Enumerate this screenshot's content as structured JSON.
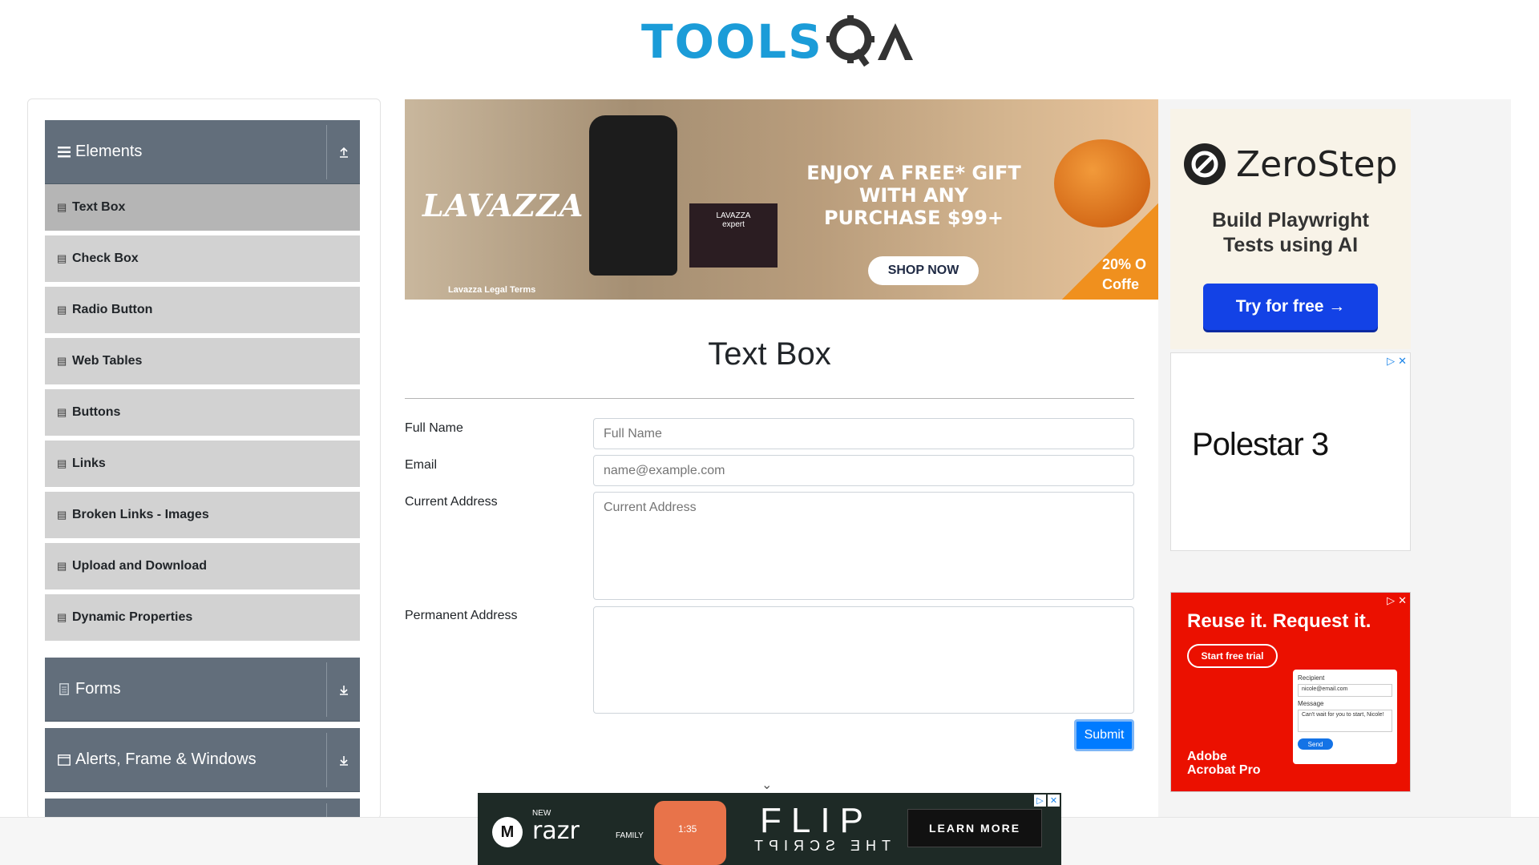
{
  "header": {
    "logo_tools": "TOOLS",
    "logo_qa": "QA"
  },
  "sidebar": {
    "groups": [
      {
        "label": "Elements",
        "expanded": true
      },
      {
        "label": "Forms",
        "expanded": false
      },
      {
        "label": "Alerts, Frame & Windows",
        "expanded": false
      }
    ],
    "items": [
      {
        "label": "Text Box",
        "active": true
      },
      {
        "label": "Check Box"
      },
      {
        "label": "Radio Button"
      },
      {
        "label": "Web Tables"
      },
      {
        "label": "Buttons"
      },
      {
        "label": "Links"
      },
      {
        "label": "Broken Links - Images"
      },
      {
        "label": "Upload and Download"
      },
      {
        "label": "Dynamic Properties"
      }
    ]
  },
  "top_ad": {
    "brand": "LAVAZZA",
    "headline_1": "ENJOY A FREE* GIFT",
    "headline_2": "WITH ANY",
    "headline_3": "PURCHASE $99+",
    "cta": "SHOP NOW",
    "legal": "Lavazza Legal Terms",
    "corner_1": "20% O",
    "corner_2": "Coffe",
    "box_label_1": "LAVAZZA",
    "box_label_2": "expert"
  },
  "main": {
    "title": "Text Box",
    "fields": {
      "full_name_label": "Full Name",
      "full_name_placeholder": "Full Name",
      "email_label": "Email",
      "email_placeholder": "name@example.com",
      "current_address_label": "Current Address",
      "current_address_placeholder": "Current Address",
      "permanent_address_label": "Permanent Address",
      "permanent_address_placeholder": ""
    },
    "submit_label": "Submit"
  },
  "right_ads": {
    "zerostep": {
      "name": "ZeroStep",
      "tagline_1": "Build Playwright",
      "tagline_2": "Tests using AI",
      "cta": "Try for free →"
    },
    "polestar": {
      "name": "Polestar 3"
    },
    "adobe": {
      "headline": "Reuse it. Request it.",
      "cta": "Start free trial",
      "brand_1": "Adobe",
      "brand_2": "Acrobat Pro",
      "recipient_label": "Recipient",
      "recipient_value": "nicole@email.com",
      "message_label": "Message",
      "message_value": "Can't wait for you to start, Nicole!",
      "send": "Send"
    }
  },
  "bottom_ad": {
    "new": "NEW",
    "brand": "razr",
    "family": "FAMILY",
    "headline": "FLIP",
    "sub": "THE SCRIPT",
    "cta": "LEARN MORE",
    "phone_time": "1:35"
  },
  "colors": {
    "accent": "#007bff",
    "sidebar_header": "#626e7b",
    "menu_item": "#d2d2d2",
    "logo_blue": "#1b9cd8"
  },
  "icons": {
    "elements": "hamburger-icon",
    "menu_item": "book-icon",
    "collapse": "arrow-up-icon",
    "expand": "arrow-down-icon",
    "forms": "document-icon",
    "alerts": "window-icon"
  }
}
